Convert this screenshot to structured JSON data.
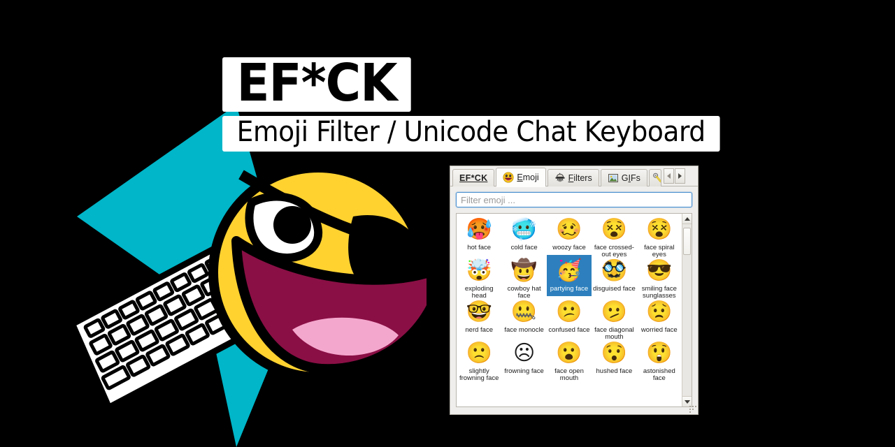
{
  "banner": {
    "title": "EF*CK",
    "subtitle": "Emoji Filter / Unicode Chat Keyboard",
    "logo_name": "awesome-face-eyepatch-keyboard-logo",
    "accent_cyan": "#00b6c8",
    "face_yellow": "#ffd230",
    "mouth_maroon": "#8a0f45",
    "tongue_pink": "#f4a7cd",
    "background": "#000000"
  },
  "window": {
    "tabs": [
      {
        "label": "EF*CK",
        "icon": "",
        "icon_name": "none",
        "active": false,
        "is_label_tab": true,
        "mnemonic": ""
      },
      {
        "label": "Emoji",
        "icon": "",
        "icon_name": "grinning-face-icon",
        "active": true,
        "is_label_tab": false,
        "mnemonic": "E"
      },
      {
        "label": "Filters",
        "icon": "",
        "icon_name": "strainer-funnel-icon",
        "active": false,
        "is_label_tab": false,
        "mnemonic": "F"
      },
      {
        "label": "GIFs",
        "icon": "",
        "icon_name": "image-icon",
        "active": false,
        "is_label_tab": false,
        "mnemonic": "I"
      },
      {
        "label": "",
        "icon": "",
        "icon_name": "key-icon",
        "active": false,
        "is_label_tab": false,
        "mnemonic": ""
      }
    ],
    "tab_nav": {
      "prev_label": "◂",
      "next_label": "▸"
    },
    "search": {
      "placeholder": "Filter emoji ...",
      "value": ""
    },
    "scrollbar": {
      "up_label": "▲",
      "down_label": "▼",
      "thumb_position_pct": 2,
      "thumb_size_pct": 16
    },
    "selection_color": "#2d80bd",
    "grid": {
      "columns": 5,
      "items": [
        {
          "label": "hot face",
          "emoji": "🥵",
          "selected": false
        },
        {
          "label": "cold face",
          "emoji": "🥶",
          "selected": false
        },
        {
          "label": "woozy face",
          "emoji": "🥴",
          "selected": false
        },
        {
          "label": "face crossed-out eyes",
          "emoji": "😵",
          "selected": false
        },
        {
          "label": "face spiral eyes",
          "emoji": "😵",
          "selected": false
        },
        {
          "label": "exploding head",
          "emoji": "🤯",
          "selected": false
        },
        {
          "label": "cowboy hat face",
          "emoji": "🤠",
          "selected": false
        },
        {
          "label": "partying face",
          "emoji": "🥳",
          "selected": true
        },
        {
          "label": "disguised face",
          "emoji": "🥸",
          "selected": false
        },
        {
          "label": "smiling face sunglasses",
          "emoji": "😎",
          "selected": false
        },
        {
          "label": "nerd face",
          "emoji": "🤓",
          "selected": false
        },
        {
          "label": "face monocle",
          "emoji": "🤐",
          "selected": false
        },
        {
          "label": "confused face",
          "emoji": "😕",
          "selected": false
        },
        {
          "label": "face diagonal mouth",
          "emoji": "🫤",
          "selected": false
        },
        {
          "label": "worried face",
          "emoji": "😟",
          "selected": false
        },
        {
          "label": "slightly frowning face",
          "emoji": "🙁",
          "selected": false
        },
        {
          "label": "frowning face",
          "emoji": "☹",
          "selected": false
        },
        {
          "label": "face open mouth",
          "emoji": "😮",
          "selected": false
        },
        {
          "label": "hushed face",
          "emoji": "😯",
          "selected": false
        },
        {
          "label": "astonished face",
          "emoji": "😲",
          "selected": false
        }
      ]
    },
    "resize_grip_name": "resize-grip"
  }
}
